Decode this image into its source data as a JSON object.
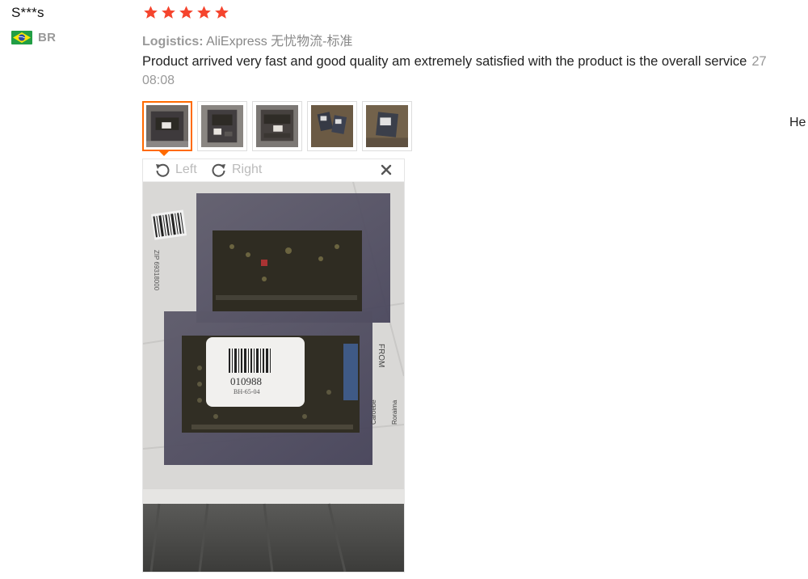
{
  "reviewer": {
    "name": "S***s",
    "country_code": "BR"
  },
  "rating": {
    "stars": 5,
    "max": 5,
    "color": "#f5442d"
  },
  "logistics": {
    "label": "Logistics:",
    "value": "AliExpress 无忧物流-标准"
  },
  "review": {
    "text": "Product arrived very fast and good quality am extremely satisfied with the product is the overall service",
    "date": "27",
    "time": "08:08"
  },
  "side_text": "He",
  "viewer": {
    "left_label": "Left",
    "right_label": "Right",
    "photo_text": {
      "barcode_number": "010988",
      "barcode_sub": "BH-65-04",
      "zip": "ZIP 69318000",
      "from": "FROM",
      "town1": "Caroebe",
      "town2": "Roraima"
    }
  },
  "colors": {
    "accent": "#ff6a00",
    "star": "#f5442d"
  },
  "icons": [
    "rotate-left-icon",
    "rotate-right-icon",
    "close-icon",
    "star-icon",
    "brazil-flag-icon"
  ]
}
